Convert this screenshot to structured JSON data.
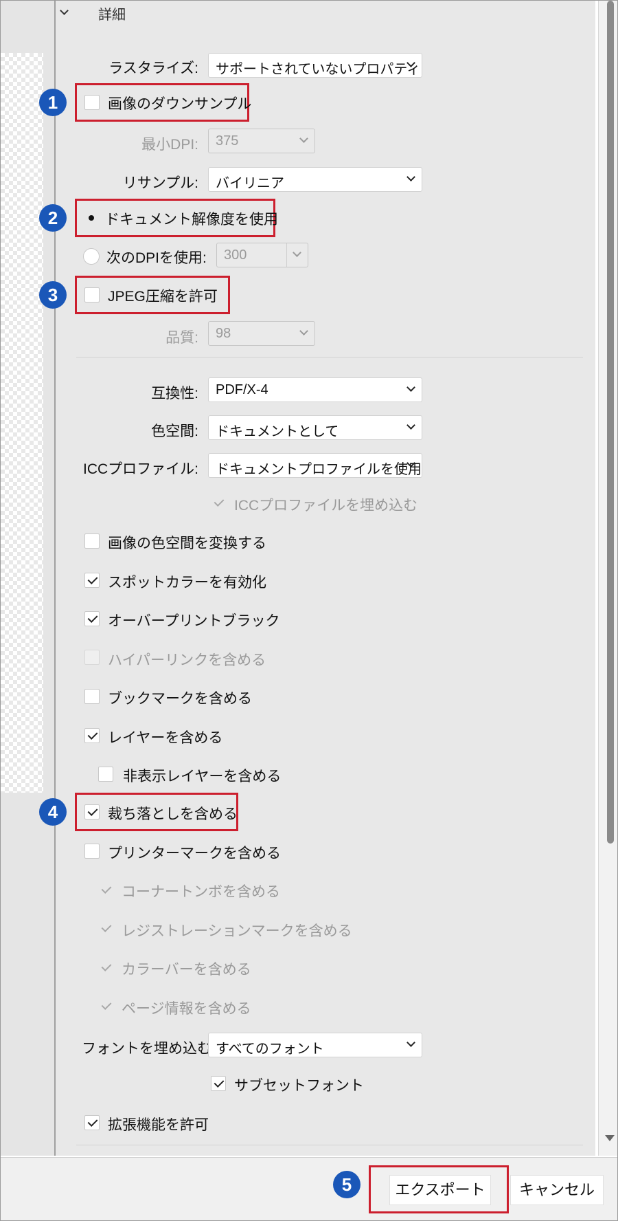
{
  "header": {
    "section_title": "詳細"
  },
  "rasterize": {
    "label": "ラスタライズ:",
    "value": "サポートされていないプロパティ"
  },
  "downsample": {
    "label": "画像のダウンサンプル",
    "checked": false
  },
  "min_dpi": {
    "label": "最小DPI:",
    "value": "375"
  },
  "resample": {
    "label": "リサンプル:",
    "value": "バイリニア"
  },
  "use_doc_res": {
    "label": "ドキュメント解像度を使用",
    "selected": true
  },
  "use_dpi": {
    "label": "次のDPIを使用:",
    "value": "300"
  },
  "jpeg": {
    "label": "JPEG圧縮を許可",
    "checked": false
  },
  "quality": {
    "label": "品質:",
    "value": "98"
  },
  "compat": {
    "label": "互換性:",
    "value": "PDF/X-4"
  },
  "colorspace": {
    "label": "色空間:",
    "value": "ドキュメントとして"
  },
  "icc": {
    "label": "ICCプロファイル:",
    "value": "ドキュメントプロファイルを使用"
  },
  "embed_icc": {
    "label": "ICCプロファイルを埋め込む"
  },
  "checks": {
    "convert_color": "画像の色空間を変換する",
    "spot": "スポットカラーを有効化",
    "overprint": "オーバープリントブラック",
    "hyperlinks": "ハイパーリンクを含める",
    "bookmarks": "ブックマークを含める",
    "layers": "レイヤーを含める",
    "hidden_layers": "非表示レイヤーを含める",
    "bleed": "裁ち落としを含める",
    "printer_marks": "プリンターマークを含める",
    "corner_marks": "コーナートンボを含める",
    "registration": "レジストレーションマークを含める",
    "color_bars": "カラーバーを含める",
    "page_info": "ページ情報を含める",
    "subset_font": "サブセットフォント",
    "extensions": "拡張機能を許可"
  },
  "embed_fonts": {
    "label": "フォントを埋め込む:",
    "value": "すべてのフォント"
  },
  "badges": [
    "1",
    "2",
    "3",
    "4",
    "5"
  ],
  "footer": {
    "export": "エクスポート",
    "cancel": "キャンセル"
  },
  "colors": {
    "highlight": "#cc1f2e",
    "badge": "#1a57b8"
  }
}
